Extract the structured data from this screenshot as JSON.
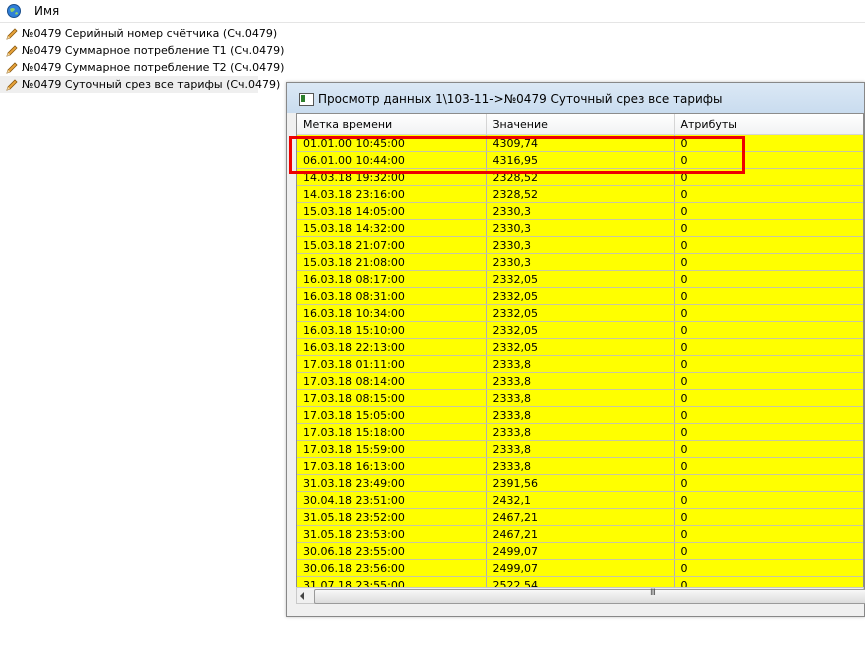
{
  "tree": {
    "header_label": "Имя",
    "header_icon": "globe-icon",
    "item_icon": "pencil-icon",
    "items": [
      "№0479 Серийный номер счётчика (Сч.0479)",
      "№0479 Суммарное потребление Т1 (Сч.0479)",
      "№0479 Суммарное потребление Т2 (Сч.0479)",
      "№0479 Суточный срез все тарифы (Сч.0479)"
    ]
  },
  "dialog": {
    "title": "Просмотр данных 1\\103-11->№0479 Суточный срез все тарифы",
    "columns": [
      "Метка времени",
      "Значение",
      "Атрибуты"
    ],
    "rows": [
      [
        "01.01.00 10:45:00",
        "4309,74",
        "0"
      ],
      [
        "06.01.00 10:44:00",
        "4316,95",
        "0"
      ],
      [
        "14.03.18 19:32:00",
        "2328,52",
        "0"
      ],
      [
        "14.03.18 23:16:00",
        "2328,52",
        "0"
      ],
      [
        "15.03.18 14:05:00",
        "2330,3",
        "0"
      ],
      [
        "15.03.18 14:32:00",
        "2330,3",
        "0"
      ],
      [
        "15.03.18 21:07:00",
        "2330,3",
        "0"
      ],
      [
        "15.03.18 21:08:00",
        "2330,3",
        "0"
      ],
      [
        "16.03.18 08:17:00",
        "2332,05",
        "0"
      ],
      [
        "16.03.18 08:31:00",
        "2332,05",
        "0"
      ],
      [
        "16.03.18 10:34:00",
        "2332,05",
        "0"
      ],
      [
        "16.03.18 15:10:00",
        "2332,05",
        "0"
      ],
      [
        "16.03.18 22:13:00",
        "2332,05",
        "0"
      ],
      [
        "17.03.18 01:11:00",
        "2333,8",
        "0"
      ],
      [
        "17.03.18 08:14:00",
        "2333,8",
        "0"
      ],
      [
        "17.03.18 08:15:00",
        "2333,8",
        "0"
      ],
      [
        "17.03.18 15:05:00",
        "2333,8",
        "0"
      ],
      [
        "17.03.18 15:18:00",
        "2333,8",
        "0"
      ],
      [
        "17.03.18 15:59:00",
        "2333,8",
        "0"
      ],
      [
        "17.03.18 16:13:00",
        "2333,8",
        "0"
      ],
      [
        "31.03.18 23:49:00",
        "2391,56",
        "0"
      ],
      [
        "30.04.18 23:51:00",
        "2432,1",
        "0"
      ],
      [
        "31.05.18 23:52:00",
        "2467,21",
        "0"
      ],
      [
        "31.05.18 23:53:00",
        "2467,21",
        "0"
      ],
      [
        "30.06.18 23:55:00",
        "2499,07",
        "0"
      ],
      [
        "30.06.18 23:56:00",
        "2499,07",
        "0"
      ],
      [
        "31.07.18 23:55:00",
        "2522,54",
        "0"
      ]
    ],
    "scrollbar_grip": "III"
  },
  "colors": {
    "row_highlight": "#ffff00",
    "annotation_box": "#ee0000"
  }
}
